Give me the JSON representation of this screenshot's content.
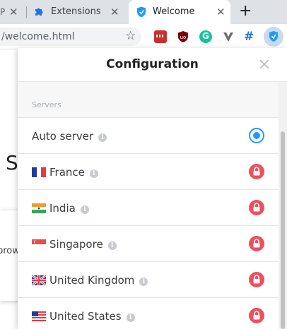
{
  "tabs": [
    {
      "label": "P",
      "has_close": true
    },
    {
      "label": "Extensions",
      "favicon": "puzzle-icon",
      "has_close": true
    },
    {
      "label": "Welcome",
      "favicon": "hotspot-shield-icon",
      "active": true,
      "has_close": true
    }
  ],
  "toolbar": {
    "url": "/welcome.html",
    "bookmark_icon": "star-icon",
    "extensions": [
      "lastpass-icon",
      "ublock-icon",
      "grammarly-icon",
      "vimium-icon",
      "hash-icon",
      "hotspot-shield-icon"
    ],
    "grammarly_glyph": "G",
    "hash_glyph": "#"
  },
  "background": {
    "heading_fragment": "S",
    "card_fragment": "brow"
  },
  "popup": {
    "title": "Configuration",
    "section_label": "Servers",
    "servers": [
      {
        "name": "Auto server",
        "flag": "",
        "status": "selected"
      },
      {
        "name": "France",
        "flag": "fr-flag-icon",
        "status": "locked"
      },
      {
        "name": "India",
        "flag": "in-flag-icon",
        "status": "locked"
      },
      {
        "name": "Singapore",
        "flag": "sg-flag-icon",
        "status": "locked"
      },
      {
        "name": "United Kingdom",
        "flag": "gb-flag-icon",
        "status": "locked"
      },
      {
        "name": "United States",
        "flag": "us-flag-icon",
        "status": "locked"
      }
    ],
    "info_glyph": "i"
  },
  "colors": {
    "accent": "#1e9bff",
    "lock": "#ef4f5c"
  }
}
